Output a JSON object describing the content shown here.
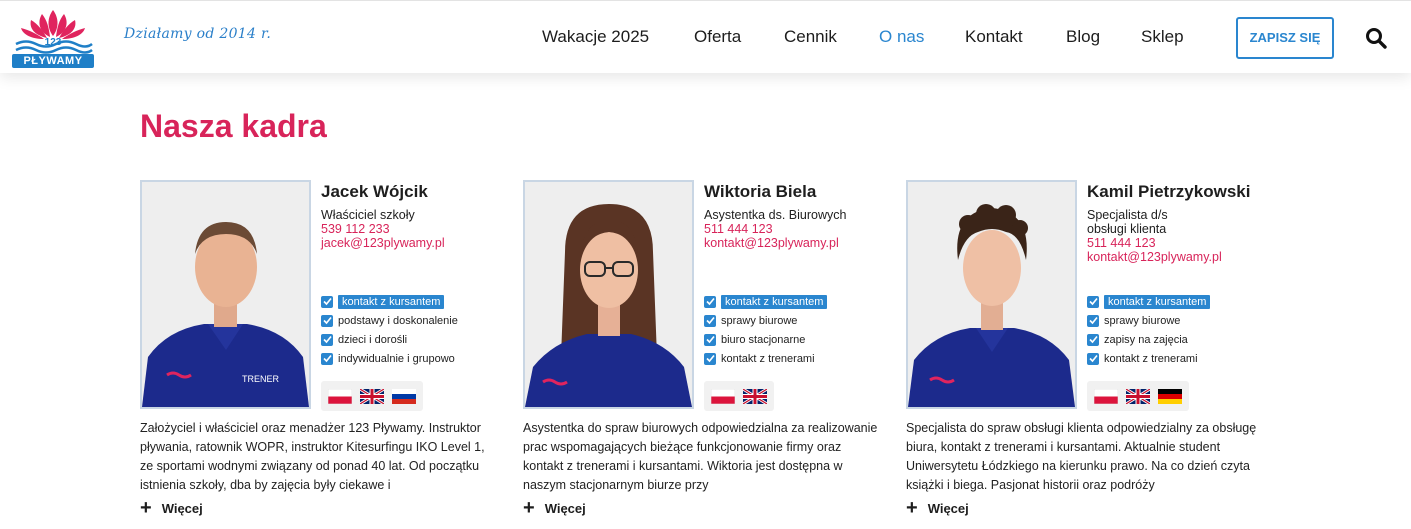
{
  "header": {
    "logo_text": "PŁYWAMY",
    "logo_number": "123",
    "tagline": "Działamy od 2014 r.",
    "nav": [
      {
        "label": "Wakacje 2025",
        "active": false
      },
      {
        "label": "Oferta",
        "active": false
      },
      {
        "label": "Cennik",
        "active": false
      },
      {
        "label": "O nas",
        "active": true
      },
      {
        "label": "Kontakt",
        "active": false
      },
      {
        "label": "Blog",
        "active": false
      },
      {
        "label": "Sklep",
        "active": false
      }
    ],
    "cta_label": "ZAPISZ SIĘ"
  },
  "main": {
    "heading": "Nasza kadra",
    "more_label": "Więcej",
    "staff": [
      {
        "name": "Jacek Wójcik",
        "role": "Właściciel szkoły",
        "phone": "539 112 233",
        "email": "jacek@123plywamy.pl",
        "tags": [
          "kontakt z kursantem",
          "podstawy i doskonalenie",
          "dzieci i dorośli",
          "indywidualnie i grupowo"
        ],
        "flags": [
          "pl",
          "gb",
          "ru"
        ],
        "bio": "Założyciel i właściciel oraz menadżer 123 Pływamy. Instruktor pływania, ratownik WOPR, instruktor Kitesurfingu IKO Level 1, ze sportami wodnymi związany od ponad 40 lat. Od początku istnienia szkoły, dba by zajęcia były ciekawe i"
      },
      {
        "name": "Wiktoria Biela",
        "role": "Asystentka ds. Biurowych",
        "phone": "511 444 123",
        "email": "kontakt@123plywamy.pl",
        "tags": [
          "kontakt z kursantem",
          "sprawy biurowe",
          "biuro stacjonarne",
          "kontakt z trenerami"
        ],
        "flags": [
          "pl",
          "gb"
        ],
        "bio": "Asystentka do spraw biurowych odpowiedzialna za realizowanie prac wspomagających bieżące funkcjonowanie firmy oraz kontakt z trenerami i kursantami. Wiktoria jest dostępna w naszym stacjonarnym biurze przy"
      },
      {
        "name": "Kamil Pietrzykowski",
        "role": "Specjalista d/s obsługi klienta",
        "phone": "511 444 123",
        "email": "kontakt@123plywamy.pl",
        "tags": [
          "kontakt z kursantem",
          "sprawy biurowe",
          "zapisy na zajęcia",
          "kontakt z trenerami"
        ],
        "flags": [
          "pl",
          "gb",
          "de"
        ],
        "bio": "Specjalista do spraw obsługi klienta odpowiedzialny za obsługę biura, kontakt z trenerami i kursantami. Aktualnie student Uniwersytetu Łódzkiego na kierunku prawo. Na co dzień czyta książki i biega. Pasjonat historii oraz podróży"
      }
    ]
  },
  "colors": {
    "brand_blue": "#2a86cf",
    "accent_pink": "#d8245a",
    "shirt_navy": "#1c2a8c"
  },
  "icons": {
    "search": "search-icon",
    "check": "check-icon",
    "plus": "plus-icon"
  }
}
